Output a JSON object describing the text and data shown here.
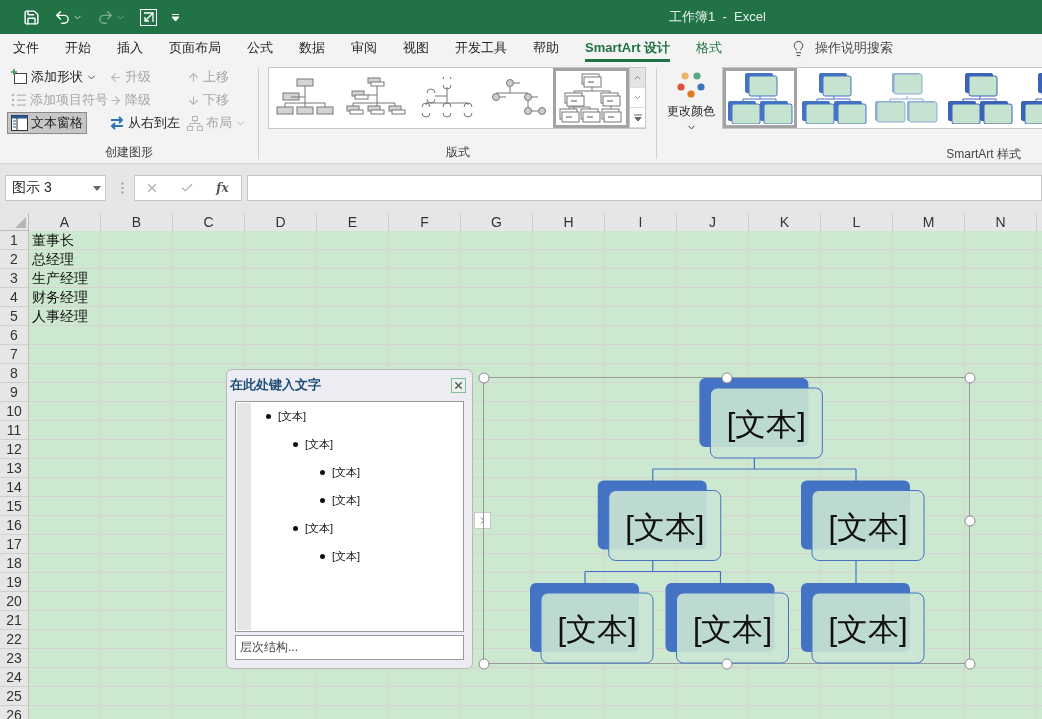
{
  "title_bar": {
    "title": "工作簿1  -  Excel"
  },
  "menu_tabs": [
    {
      "label": "文件",
      "selected": false,
      "contextual": false
    },
    {
      "label": "开始",
      "selected": false,
      "contextual": false
    },
    {
      "label": "插入",
      "selected": false,
      "contextual": false
    },
    {
      "label": "页面布局",
      "selected": false,
      "contextual": false
    },
    {
      "label": "公式",
      "selected": false,
      "contextual": false
    },
    {
      "label": "数据",
      "selected": false,
      "contextual": false
    },
    {
      "label": "审阅",
      "selected": false,
      "contextual": false
    },
    {
      "label": "视图",
      "selected": false,
      "contextual": false
    },
    {
      "label": "开发工具",
      "selected": false,
      "contextual": false
    },
    {
      "label": "帮助",
      "selected": false,
      "contextual": false
    },
    {
      "label": "SmartArt 设计",
      "selected": true,
      "contextual": true
    },
    {
      "label": "格式",
      "selected": false,
      "contextual": true
    }
  ],
  "tell_me": {
    "label": "操作说明搜索"
  },
  "ribbon": {
    "create_group": {
      "label": "创建图形",
      "columns": [
        [
          {
            "kind": "add",
            "label": "添加形状",
            "disabled": false,
            "pressed": false,
            "dropdown": true
          },
          {
            "kind": "bullet",
            "label": "添加项目符号",
            "disabled": true,
            "pressed": false,
            "dropdown": false
          },
          {
            "kind": "pane",
            "label": "文本窗格",
            "disabled": false,
            "pressed": true,
            "dropdown": false
          }
        ],
        [
          {
            "kind": "promote",
            "label": "升级",
            "disabled": true,
            "pressed": false,
            "dropdown": false
          },
          {
            "kind": "demote",
            "label": "降级",
            "disabled": true,
            "pressed": false,
            "dropdown": false
          },
          {
            "kind": "rtl",
            "label": "从右到左",
            "disabled": false,
            "pressed": false,
            "dropdown": false
          }
        ],
        [
          {
            "kind": "up",
            "label": "上移",
            "disabled": true,
            "pressed": false,
            "dropdown": false
          },
          {
            "kind": "down",
            "label": "下移",
            "disabled": true,
            "pressed": false,
            "dropdown": false
          },
          {
            "kind": "layout",
            "label": "布局",
            "disabled": true,
            "pressed": false,
            "dropdown": true
          }
        ]
      ]
    },
    "layouts": {
      "label": "版式",
      "items": [
        {
          "kind": "org",
          "selected": false
        },
        {
          "kind": "name-title",
          "selected": false
        },
        {
          "kind": "half-circle",
          "selected": false
        },
        {
          "kind": "circle",
          "selected": false
        },
        {
          "kind": "stacked",
          "selected": true
        }
      ]
    },
    "change_colors": {
      "label": "更改颜色"
    },
    "styles": {
      "label": "SmartArt 样式",
      "items": [
        {
          "kind": "offset",
          "selected": true
        },
        {
          "kind": "shadow",
          "selected": false
        },
        {
          "kind": "muted",
          "selected": false
        },
        {
          "kind": "deep",
          "selected": false
        },
        {
          "kind": "deep",
          "selected": false
        }
      ]
    }
  },
  "formula_bar": {
    "name_box": "图示 3",
    "function_label": "fx"
  },
  "sheet": {
    "columns": [
      "A",
      "B",
      "C",
      "D",
      "E",
      "F",
      "G",
      "H",
      "I",
      "J",
      "K",
      "L",
      "M",
      "N"
    ],
    "rows": [
      {
        "label": "1",
        "cells": [
          "董事长"
        ]
      },
      {
        "label": "2",
        "cells": [
          "总经理"
        ]
      },
      {
        "label": "3",
        "cells": [
          "生产经理"
        ]
      },
      {
        "label": "4",
        "cells": [
          "财务经理"
        ]
      },
      {
        "label": "5",
        "cells": [
          "人事经理"
        ]
      },
      {
        "label": "6"
      },
      {
        "label": "7"
      },
      {
        "label": "8"
      },
      {
        "label": "9"
      },
      {
        "label": "10"
      },
      {
        "label": "11"
      },
      {
        "label": "12"
      },
      {
        "label": "13"
      },
      {
        "label": "14"
      },
      {
        "label": "15"
      },
      {
        "label": "16"
      },
      {
        "label": "17"
      },
      {
        "label": "18"
      },
      {
        "label": "19"
      },
      {
        "label": "20"
      },
      {
        "label": "21"
      },
      {
        "label": "22"
      },
      {
        "label": "23"
      },
      {
        "label": "24"
      },
      {
        "label": "25"
      },
      {
        "label": "26"
      }
    ]
  },
  "text_pane": {
    "title": "在此处键入文字",
    "footer": "层次结构...",
    "items": [
      {
        "text": "[文本]",
        "children": [
          {
            "text": "[文本]",
            "children": [
              {
                "text": "[文本]"
              },
              {
                "text": "[文本]"
              }
            ]
          },
          {
            "text": "[文本]",
            "children": [
              {
                "text": "[文本]"
              }
            ]
          }
        ]
      }
    ]
  },
  "smartart": {
    "nodes": [
      {
        "label": "[文本]",
        "children": [
          {
            "label": "[文本]",
            "children": [
              {
                "label": "[文本]"
              },
              {
                "label": "[文本]"
              }
            ]
          },
          {
            "label": "[文本]",
            "children": [
              {
                "label": "[文本]"
              }
            ]
          }
        ]
      }
    ]
  }
}
